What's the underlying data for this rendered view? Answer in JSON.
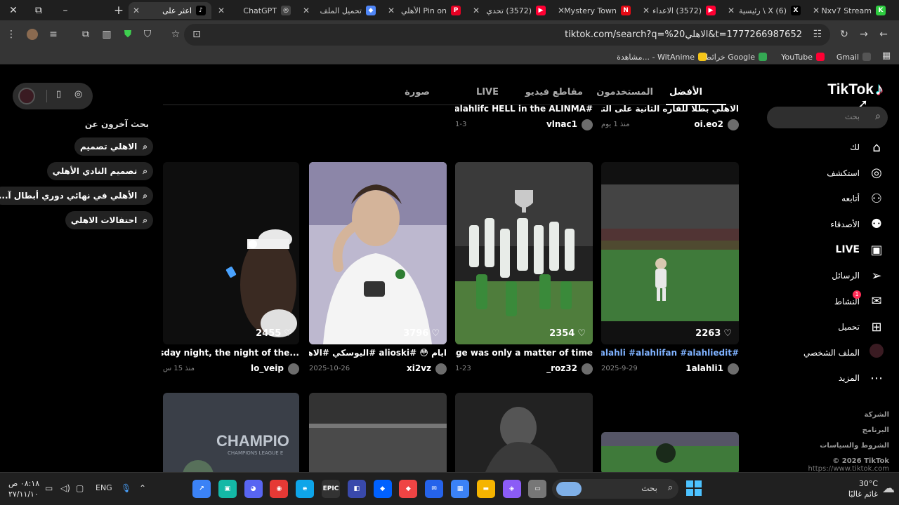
{
  "window": {
    "minimize": "–",
    "restore": "⧉",
    "close": "✕"
  },
  "tabs": [
    {
      "title": "Nxv7 Stream",
      "color": "#2ecc40",
      "glyph": "K",
      "active": false
    },
    {
      "title": "(6) X \\ رئيسية",
      "color": "#000000",
      "glyph": "X",
      "active": false
    },
    {
      "title": "(3572) الاعداء",
      "color": "#ff0033",
      "glyph": "▶",
      "active": false
    },
    {
      "title": "Mystery Town",
      "color": "#e50914",
      "glyph": "N",
      "active": false
    },
    {
      "title": "(3572) تحدي",
      "color": "#ff0033",
      "glyph": "▶",
      "active": false
    },
    {
      "title": "Pin on الأهلي",
      "color": "#e60023",
      "glyph": "P",
      "active": false
    },
    {
      "title": "تحميل الملف",
      "color": "#4f86f7",
      "glyph": "◆",
      "active": false
    },
    {
      "title": "ChatGPT",
      "color": "#444444",
      "glyph": "◎",
      "active": false
    },
    {
      "title": "اعثر على",
      "color": "#000000",
      "glyph": "♪",
      "active": true
    }
  ],
  "new_tab": "+",
  "toolbar": {
    "url": "tiktok.com/search?q=%20الاهلي&t=1777266987652"
  },
  "bookmarks": [
    {
      "label": "Gmail",
      "color": "#555555"
    },
    {
      "label": "YouTube",
      "color": "#ff0033"
    },
    {
      "label": "خرائط Google",
      "color": "#34a853"
    },
    {
      "label": "مشاهدة... - WitAnime",
      "color": "#f5c518"
    }
  ],
  "tiktok": {
    "logo": "TikTok",
    "search_placeholder": "بحث",
    "nav": [
      {
        "label": "لك",
        "icon": "⌂"
      },
      {
        "label": "استكشف",
        "icon": "◎"
      },
      {
        "label": "أتابعه",
        "icon": "⚇"
      },
      {
        "label": "الأصدقاء",
        "icon": "⚉"
      },
      {
        "label": "LIVE",
        "icon": "▣"
      },
      {
        "label": "الرسائل",
        "icon": "➢"
      },
      {
        "label": "النشاط",
        "icon": "✉"
      },
      {
        "label": "تحميل",
        "icon": "⊞"
      },
      {
        "label": "الملف الشخصي",
        "icon": ""
      },
      {
        "label": "المزيد",
        "icon": "⋯"
      }
    ],
    "activity_badge": "1",
    "footer": [
      "الشركة",
      "البرنامج",
      "الشروط والسياسات",
      "© 2026 TikTok"
    ],
    "footer_url": "https://www.tiktok.com",
    "search_tabs": [
      "الأفضل",
      "المستخدمون",
      "مقاطع فيديو",
      "LIVE",
      "صورة"
    ],
    "row1": [
      {
        "caption": "الاهلي بطلاً للقاره الثانية على التوالي 👑 💚 ! ...",
        "user": "oi.eo2",
        "date": "منذ 1 يوم"
      },
      {
        "caption": "#alahlifc HELL in the ALINMA ...",
        "user": "vlnac1",
        "date": "1-3"
      }
    ],
    "videos": [
      {
        "views": "2263",
        "caption": "#alahli #alahlifan #alahliedit",
        "user": "1alahli1",
        "date": "2025-9-29"
      },
      {
        "views": "2354",
        "caption": "al stage was only a matter of time...",
        "user": "_roz32",
        "date": "1-23"
      },
      {
        "views": "3796",
        "caption": "ايام 😳 #alioski #اليوسكي #الاهلي ...",
        "user": "xi2vz",
        "date": "2025-10-26"
      },
      {
        "views": "2455",
        "caption": "...ednesday night, the night of the",
        "user": "lo_veip",
        "date": "منذ 15 س"
      }
    ],
    "row3_overlay": {
      "champ": "CHAMPIO",
      "champ_sub": "CHAMPIONS LEAGUE E"
    },
    "others_title": "بحث آخرون عن",
    "suggestions": [
      "الاهلي تصميم",
      "تصميم النادي الأهلي",
      "...الأهلي في نهائي دوري أبطال آ",
      "احتفالات الاهلي"
    ]
  },
  "taskbar": {
    "search_label": "بحث",
    "temp": "30°C",
    "weather": "غائم غالبًا",
    "time": "٠٨:١٨ ص",
    "date": "٢٧/١١/١٠",
    "lang": "ENG",
    "apps": [
      {
        "name": "tk-app-1",
        "color": "#3b82f6",
        "glyph": "↗"
      },
      {
        "name": "tk-app-2",
        "color": "#14b8a6",
        "glyph": "▣"
      },
      {
        "name": "tk-app-discord",
        "color": "#5865f2",
        "glyph": "◕"
      },
      {
        "name": "tk-app-chrome",
        "color": "#e53935",
        "glyph": "◉"
      },
      {
        "name": "tk-app-edge",
        "color": "#0ea5e9",
        "glyph": "e"
      },
      {
        "name": "tk-app-epic",
        "color": "#333333",
        "glyph": "EPIC"
      },
      {
        "name": "tk-app-7",
        "color": "#3949ab",
        "glyph": "◧"
      },
      {
        "name": "tk-app-dropbox",
        "color": "#0061ff",
        "glyph": "◆"
      },
      {
        "name": "tk-app-9",
        "color": "#ef4444",
        "glyph": "◆"
      },
      {
        "name": "tk-app-10",
        "color": "#2563eb",
        "glyph": "✉"
      },
      {
        "name": "tk-app-store",
        "color": "#3b82f6",
        "glyph": "▦"
      },
      {
        "name": "tk-app-explorer",
        "color": "#f5b400",
        "glyph": "▬"
      },
      {
        "name": "tk-app-copilot",
        "color": "#8b5cf6",
        "glyph": "◈"
      },
      {
        "name": "tk-app-14",
        "color": "#777777",
        "glyph": "▭"
      }
    ]
  }
}
